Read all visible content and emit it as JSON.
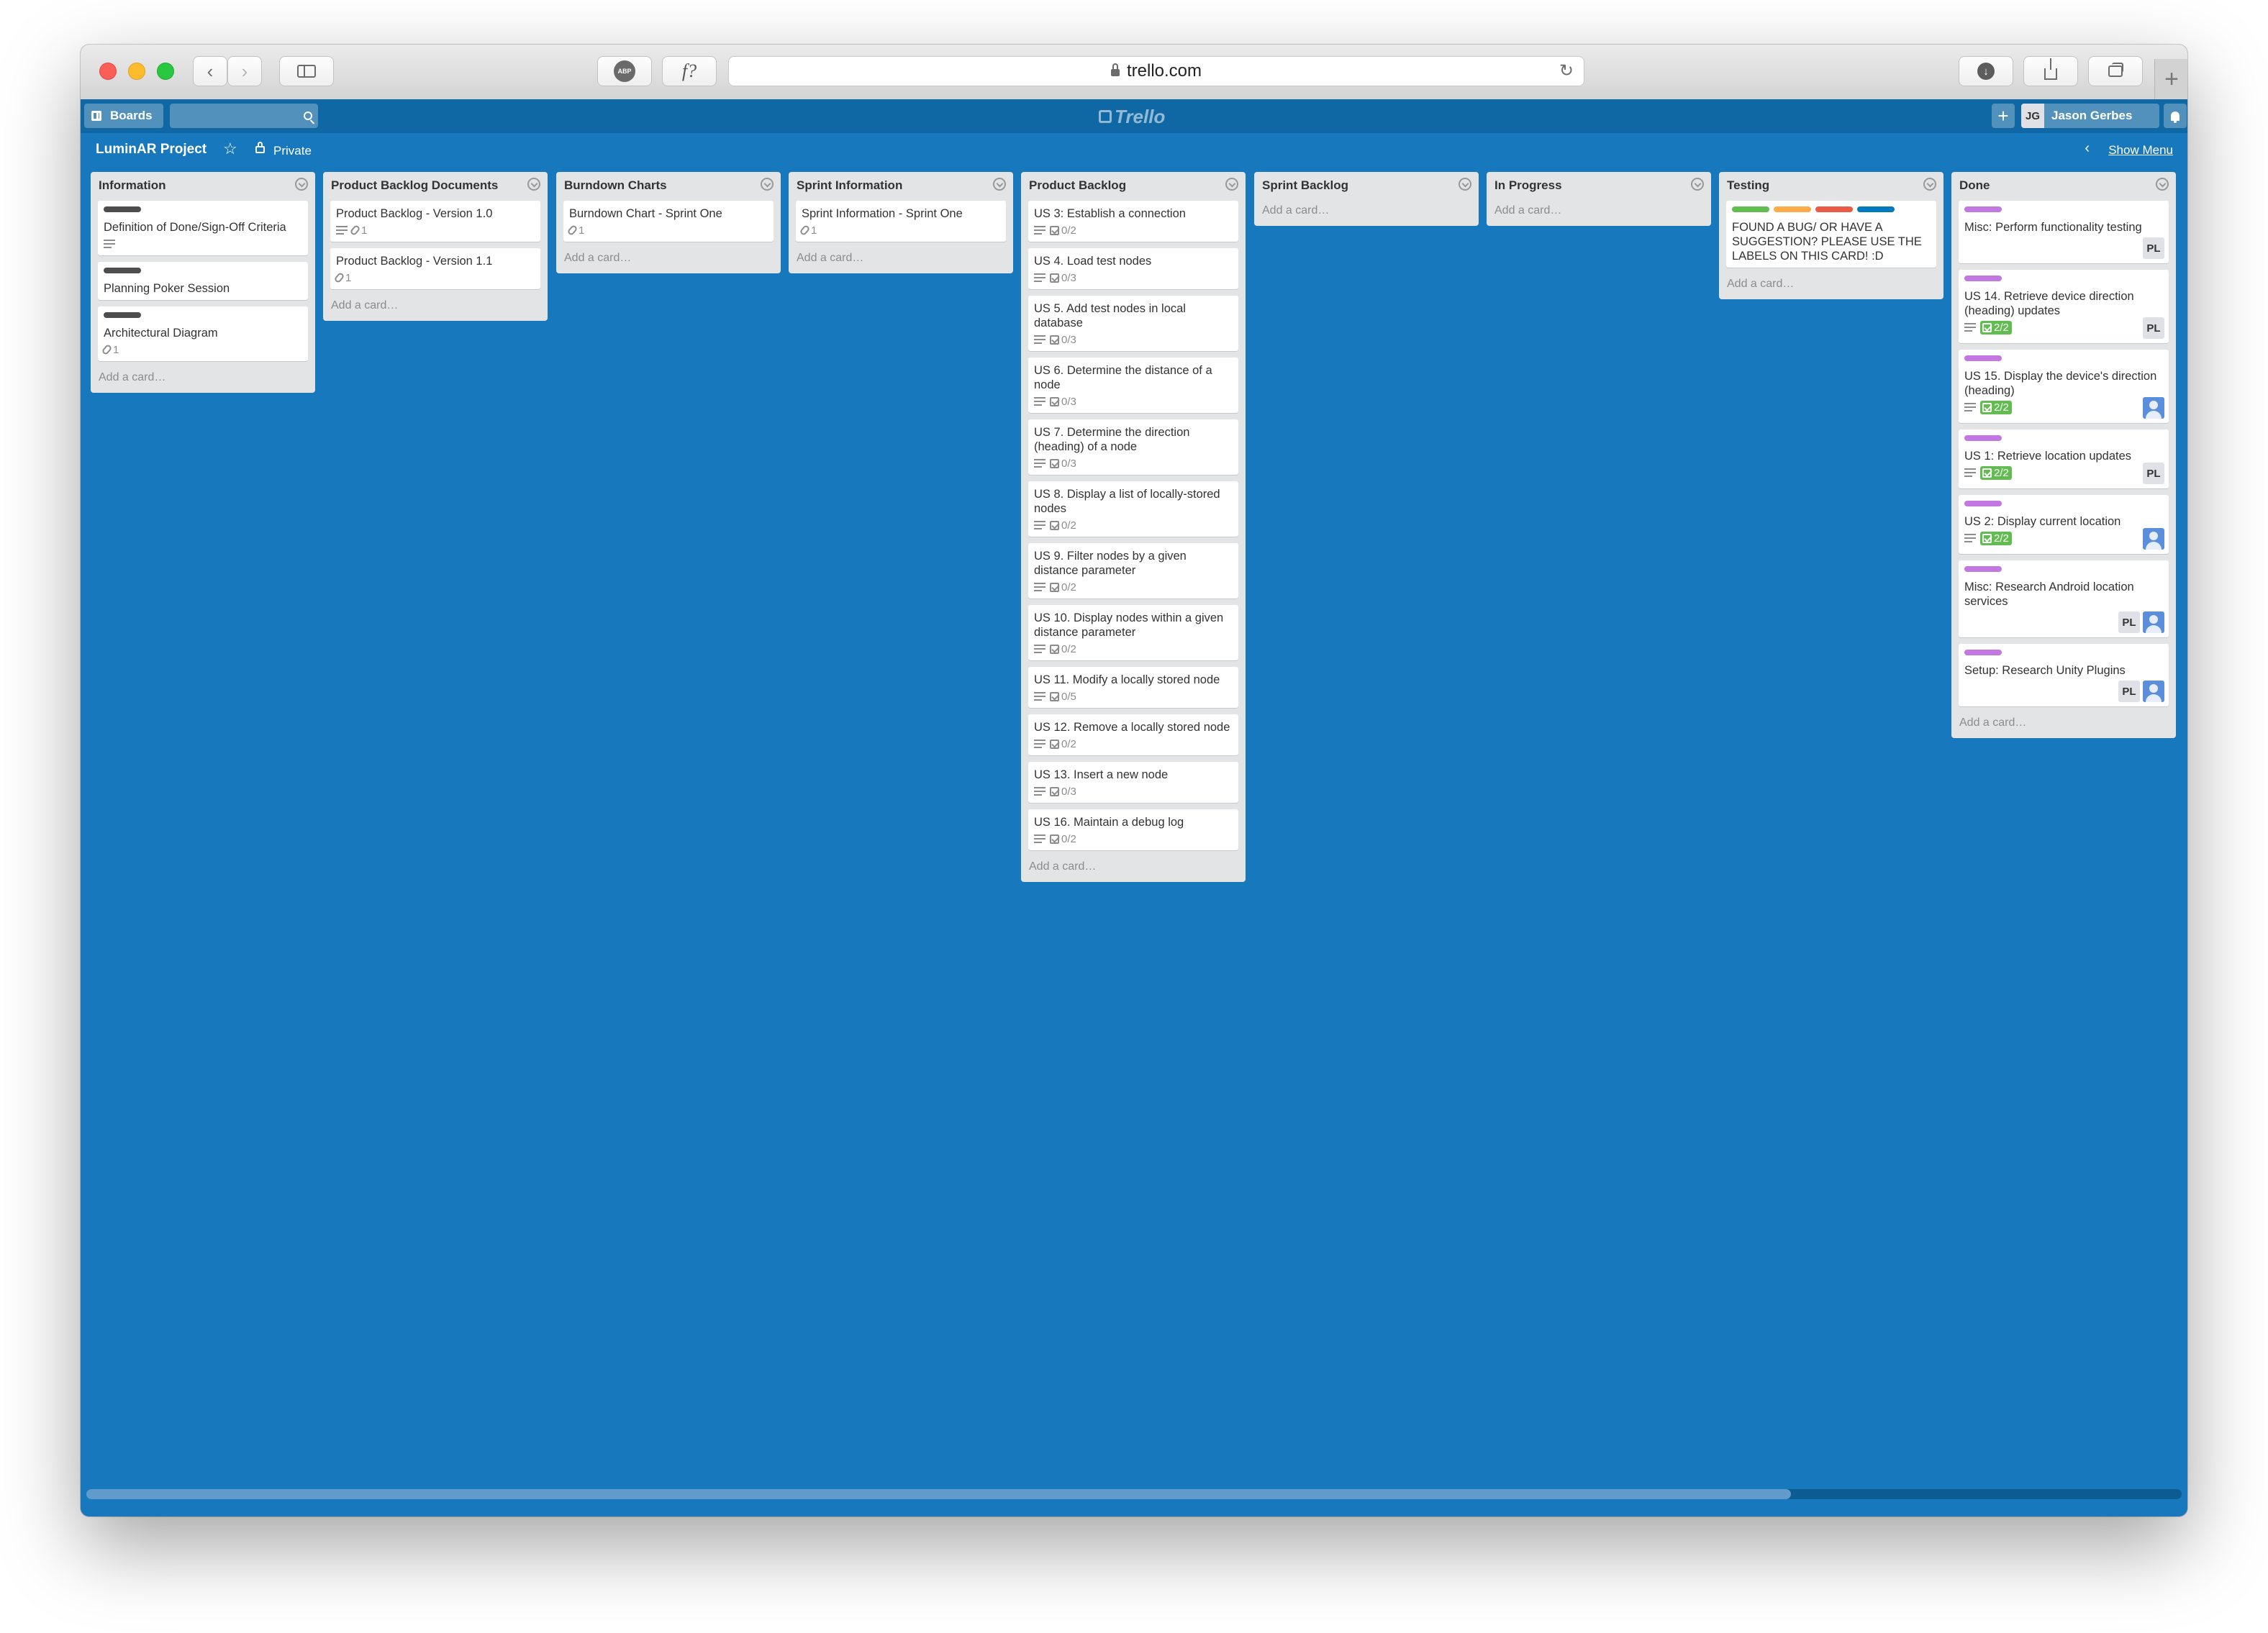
{
  "browser": {
    "url": "trello.com",
    "adblock_label": "ABP",
    "fq_label": "f?"
  },
  "header": {
    "boards_label": "Boards",
    "search_placeholder": "",
    "logo_text": "Trello",
    "add_label": "+",
    "user_initials": "JG",
    "user_name": "Jason Gerbes"
  },
  "board": {
    "name": "LuminAR Project",
    "visibility": "Private",
    "show_menu": "Show Menu"
  },
  "colors": {
    "board_bg": "#1878bd",
    "label_black": "#4d4d4d",
    "label_green": "#61bd4f",
    "label_orange": "#ffab4a",
    "label_red": "#eb5a46",
    "label_blue": "#0079bf",
    "label_purple": "#c377e0"
  },
  "add_card_label": "Add a card…",
  "lists": [
    {
      "title": "Information",
      "cards": [
        {
          "labels": [
            "label_black"
          ],
          "title": "Definition of Done/Sign-Off Criteria",
          "desc": true
        },
        {
          "labels": [
            "label_black"
          ],
          "title": "Planning Poker Session"
        },
        {
          "labels": [
            "label_black"
          ],
          "title": "Architectural Diagram",
          "attachments": "1"
        }
      ]
    },
    {
      "title": "Product Backlog Documents",
      "cards": [
        {
          "title": "Product Backlog - Version 1.0",
          "desc": true,
          "attachments": "1"
        },
        {
          "title": "Product Backlog - Version 1.1",
          "attachments": "1"
        }
      ]
    },
    {
      "title": "Burndown Charts",
      "cards": [
        {
          "title": "Burndown Chart - Sprint One",
          "attachments": "1"
        }
      ]
    },
    {
      "title": "Sprint Information",
      "cards": [
        {
          "title": "Sprint Information - Sprint One",
          "attachments": "1"
        }
      ]
    },
    {
      "title": "Product Backlog",
      "cards": [
        {
          "title": "US 3: Establish a connection",
          "desc": true,
          "checklist": "0/2"
        },
        {
          "title": "US 4. Load test nodes",
          "desc": true,
          "checklist": "0/3"
        },
        {
          "title": "US 5. Add test nodes in local database",
          "desc": true,
          "checklist": "0/3"
        },
        {
          "title": "US 6. Determine the distance of a node",
          "desc": true,
          "checklist": "0/3"
        },
        {
          "title": "US 7. Determine the direction (heading) of a node",
          "desc": true,
          "checklist": "0/3"
        },
        {
          "title": "US 8. Display a list of locally-stored nodes",
          "desc": true,
          "checklist": "0/2"
        },
        {
          "title": "US 9. Filter nodes by a given distance parameter",
          "desc": true,
          "checklist": "0/2"
        },
        {
          "title": "US 10. Display nodes within a given distance parameter",
          "desc": true,
          "checklist": "0/2"
        },
        {
          "title": "US 11. Modify a locally stored node",
          "desc": true,
          "checklist": "0/5"
        },
        {
          "title": "US 12. Remove a locally stored node",
          "desc": true,
          "checklist": "0/2"
        },
        {
          "title": "US 13. Insert a new node",
          "desc": true,
          "checklist": "0/3"
        },
        {
          "title": "US 16. Maintain a debug log",
          "desc": true,
          "checklist": "0/2"
        }
      ]
    },
    {
      "title": "Sprint Backlog",
      "cards": []
    },
    {
      "title": "In Progress",
      "cards": []
    },
    {
      "title": "Testing",
      "cards": [
        {
          "labels": [
            "label_green",
            "label_orange",
            "label_red",
            "label_blue"
          ],
          "title": "FOUND A BUG/ OR HAVE A SUGGESTION? PLEASE USE THE LABELS ON THIS CARD! :D"
        }
      ]
    },
    {
      "title": "Done",
      "cards": [
        {
          "labels": [
            "label_purple"
          ],
          "title": "Misc: Perform functionality testing",
          "members": [
            "PL"
          ]
        },
        {
          "labels": [
            "label_purple"
          ],
          "title": "US 14. Retrieve device direction (heading) updates",
          "desc": true,
          "checklist": "2/2",
          "complete": true,
          "members": [
            "PL"
          ]
        },
        {
          "labels": [
            "label_purple"
          ],
          "title": "US 15. Display the device's direction (heading)",
          "desc": true,
          "checklist": "2/2",
          "complete": true,
          "members": [
            "photo"
          ]
        },
        {
          "labels": [
            "label_purple"
          ],
          "title": "US 1: Retrieve location updates",
          "desc": true,
          "checklist": "2/2",
          "complete": true,
          "members": [
            "PL"
          ]
        },
        {
          "labels": [
            "label_purple"
          ],
          "title": "US 2: Display current location",
          "desc": true,
          "checklist": "2/2",
          "complete": true,
          "members": [
            "photo"
          ]
        },
        {
          "labels": [
            "label_purple"
          ],
          "title": "Misc: Research Android location services",
          "members": [
            "PL",
            "photo"
          ]
        },
        {
          "labels": [
            "label_purple"
          ],
          "title": "Setup: Research Unity Plugins",
          "members": [
            "PL",
            "photo"
          ]
        }
      ]
    }
  ]
}
